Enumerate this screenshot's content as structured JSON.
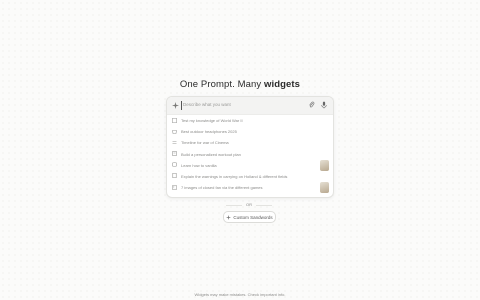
{
  "headline": {
    "prefix": "One Prompt. Many ",
    "emphasis": "widgets"
  },
  "search": {
    "placeholder": "Describe what you want"
  },
  "suggestions": [
    {
      "label": "Test my knowledge of World War II",
      "icon": "quiz-icon",
      "thumb": false
    },
    {
      "label": "Best outdoor headphones 2025",
      "icon": "shopping-icon",
      "thumb": false
    },
    {
      "label": "Timeline for war of Cinema",
      "icon": "timeline-icon",
      "thumb": false
    },
    {
      "label": "Build a personalized workout plan",
      "icon": "plan-icon",
      "thumb": false
    },
    {
      "label": "Learn how to vanilla",
      "icon": "learn-icon",
      "thumb": true
    },
    {
      "label": "Explain the warnings in carrying on Holland & different fields",
      "icon": "doc-icon",
      "thumb": false
    },
    {
      "label": "7 images of closed fan via the different games",
      "icon": "image-icon",
      "thumb": true
    }
  ],
  "divider_text": "OR",
  "custom_button": {
    "label": "Custom Sandwords",
    "icon": "sparkle-icon"
  },
  "footer": "Widgets may make mistakes. Check important info."
}
